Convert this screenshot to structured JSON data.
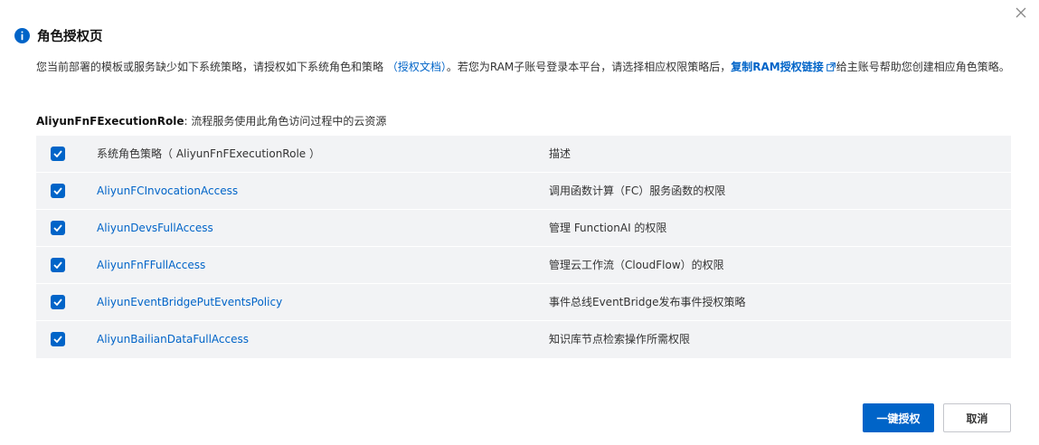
{
  "dialog": {
    "title": "角色授权页",
    "desc_part1": "您当前部署的模板或服务缺少如下系统策略，请授权如下系统角色和策略 ",
    "auth_doc_link": "（授权文档）",
    "desc_part2": "。若您为RAM子账号登录本平台，请选择相应权限策略后，",
    "copy_link": "复制RAM授权链接",
    "desc_part3": "给主账号帮助您创建相应角色策略。",
    "role_name": "AliyunFnFExecutionRole",
    "role_desc": ": 流程服务使用此角色访问过程中的云资源"
  },
  "table": {
    "header_name": "系统角色策略（ AliyunFnFExecutionRole ）",
    "header_desc": "描述",
    "rows": [
      {
        "name": "AliyunFCInvocationAccess",
        "desc": "调用函数计算（FC）服务函数的权限",
        "checked": true
      },
      {
        "name": "AliyunDevsFullAccess",
        "desc": "管理 FunctionAI 的权限",
        "checked": true
      },
      {
        "name": "AliyunFnFFullAccess",
        "desc": "管理云工作流（CloudFlow）的权限",
        "checked": true
      },
      {
        "name": "AliyunEventBridgePutEventsPolicy",
        "desc": "事件总线EventBridge发布事件授权策略",
        "checked": true
      },
      {
        "name": "AliyunBailianDataFullAccess",
        "desc": "知识库节点检索操作所需权限",
        "checked": true
      }
    ]
  },
  "buttons": {
    "confirm": "一键授权",
    "cancel": "取消"
  },
  "icons": {
    "info": "info-icon",
    "close": "close-icon",
    "checkbox": "checkbox-checked-icon",
    "external": "external-link-icon"
  },
  "colors": {
    "accent": "#0064c8",
    "table_bg": "#f2f3f5",
    "text": "#333333"
  }
}
